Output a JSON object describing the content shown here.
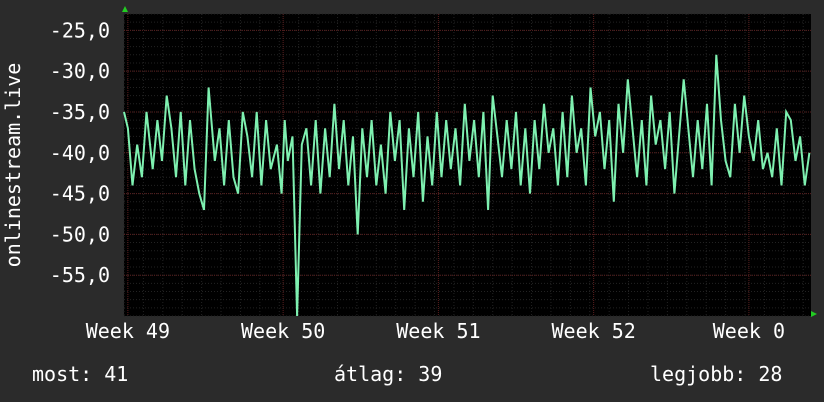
{
  "chart_data": {
    "type": "line",
    "ylabel": "onlinestream.live",
    "ylim": [
      -60,
      -23
    ],
    "yticks": [
      -25,
      -30,
      -35,
      -40,
      -45,
      -50,
      -55
    ],
    "ytick_labels": [
      "-25,0",
      "-30,0",
      "-35,0",
      "-40,0",
      "-45,0",
      "-50,0",
      "-55,0"
    ],
    "xlim": [
      48.975,
      53.4
    ],
    "xticks": [
      49,
      50,
      51,
      52,
      53
    ],
    "xtick_labels": [
      "Week 49",
      "Week 50",
      "Week 51",
      "Week 52",
      "Week 0"
    ],
    "colors": {
      "background": "#2b2b2b",
      "plot": "#000000",
      "line": "#7ef0b0",
      "grid": "#5a1e1e",
      "axis_arrow": "#22cc22"
    },
    "series": [
      {
        "color": "#7ef0b0",
        "x": [
          48.975,
          49.0,
          49.03,
          49.06,
          49.09,
          49.12,
          49.16,
          49.19,
          49.22,
          49.25,
          49.28,
          49.31,
          49.34,
          49.37,
          49.4,
          49.43,
          49.46,
          49.49,
          49.52,
          49.56,
          49.59,
          49.62,
          49.65,
          49.68,
          49.71,
          49.74,
          49.77,
          49.8,
          49.83,
          49.86,
          49.89,
          49.92,
          49.96,
          49.99,
          50.01,
          50.03,
          50.06,
          50.09,
          50.12,
          50.15,
          50.18,
          50.21,
          50.24,
          50.27,
          50.3,
          50.33,
          50.36,
          50.39,
          50.42,
          50.45,
          50.48,
          50.51,
          50.54,
          50.57,
          50.6,
          50.63,
          50.66,
          50.69,
          50.72,
          50.75,
          50.78,
          50.81,
          50.84,
          50.87,
          50.9,
          50.93,
          50.96,
          50.99,
          51.02,
          51.05,
          51.08,
          51.11,
          51.14,
          51.17,
          51.2,
          51.23,
          51.26,
          51.29,
          51.32,
          51.35,
          51.38,
          51.41,
          51.44,
          51.47,
          51.5,
          51.53,
          51.56,
          51.59,
          51.62,
          51.65,
          51.68,
          51.71,
          51.74,
          51.77,
          51.8,
          51.83,
          51.86,
          51.89,
          51.92,
          51.95,
          51.98,
          52.01,
          52.04,
          52.07,
          52.1,
          52.13,
          52.16,
          52.19,
          52.22,
          52.25,
          52.28,
          52.31,
          52.34,
          52.37,
          52.4,
          52.43,
          52.46,
          52.49,
          52.52,
          52.55,
          52.58,
          52.61,
          52.64,
          52.67,
          52.7,
          52.73,
          52.76,
          52.79,
          52.82,
          52.85,
          52.88,
          52.91,
          52.94,
          52.97,
          53.0,
          53.03,
          53.06,
          53.09,
          53.12,
          53.15,
          53.18,
          53.21,
          53.24,
          53.27,
          53.3,
          53.33,
          53.36,
          53.39
        ],
        "values": [
          -35,
          -37,
          -44,
          -39,
          -43,
          -35,
          -42,
          -36,
          -41,
          -33,
          -37,
          -43,
          -35,
          -44,
          -36,
          -42,
          -45,
          -47,
          -32,
          -41,
          -37,
          -44,
          -36,
          -43,
          -45,
          -35,
          -38,
          -43,
          -35,
          -44,
          -36,
          -42,
          -39,
          -45,
          -36,
          -41,
          -38,
          -60,
          -39,
          -37,
          -44,
          -36,
          -45,
          -37,
          -43,
          -34,
          -42,
          -36,
          -44,
          -38,
          -50,
          -37,
          -43,
          -36,
          -44,
          -39,
          -45,
          -35,
          -41,
          -36,
          -47,
          -37,
          -43,
          -35,
          -46,
          -38,
          -44,
          -35,
          -43,
          -36,
          -42,
          -37,
          -44,
          -34,
          -41,
          -36,
          -43,
          -35,
          -47,
          -33,
          -38,
          -43,
          -36,
          -42,
          -35,
          -44,
          -37,
          -45,
          -36,
          -42,
          -34,
          -40,
          -37,
          -44,
          -35,
          -43,
          -33,
          -40,
          -37,
          -44,
          -32,
          -38,
          -35,
          -42,
          -36,
          -46,
          -34,
          -40,
          -31,
          -37,
          -43,
          -36,
          -44,
          -33,
          -39,
          -36,
          -42,
          -35,
          -45,
          -38,
          -31,
          -37,
          -43,
          -36,
          -42,
          -34,
          -44,
          -28,
          -36,
          -41,
          -43,
          -34,
          -40,
          -33,
          -38,
          -41,
          -36,
          -42,
          -40,
          -43,
          -37,
          -44,
          -35,
          -36,
          -41,
          -38,
          -44,
          -40
        ]
      }
    ]
  },
  "stats": {
    "current": "most: 41",
    "average": "átlag: 39",
    "best": "legjobb: 28"
  }
}
